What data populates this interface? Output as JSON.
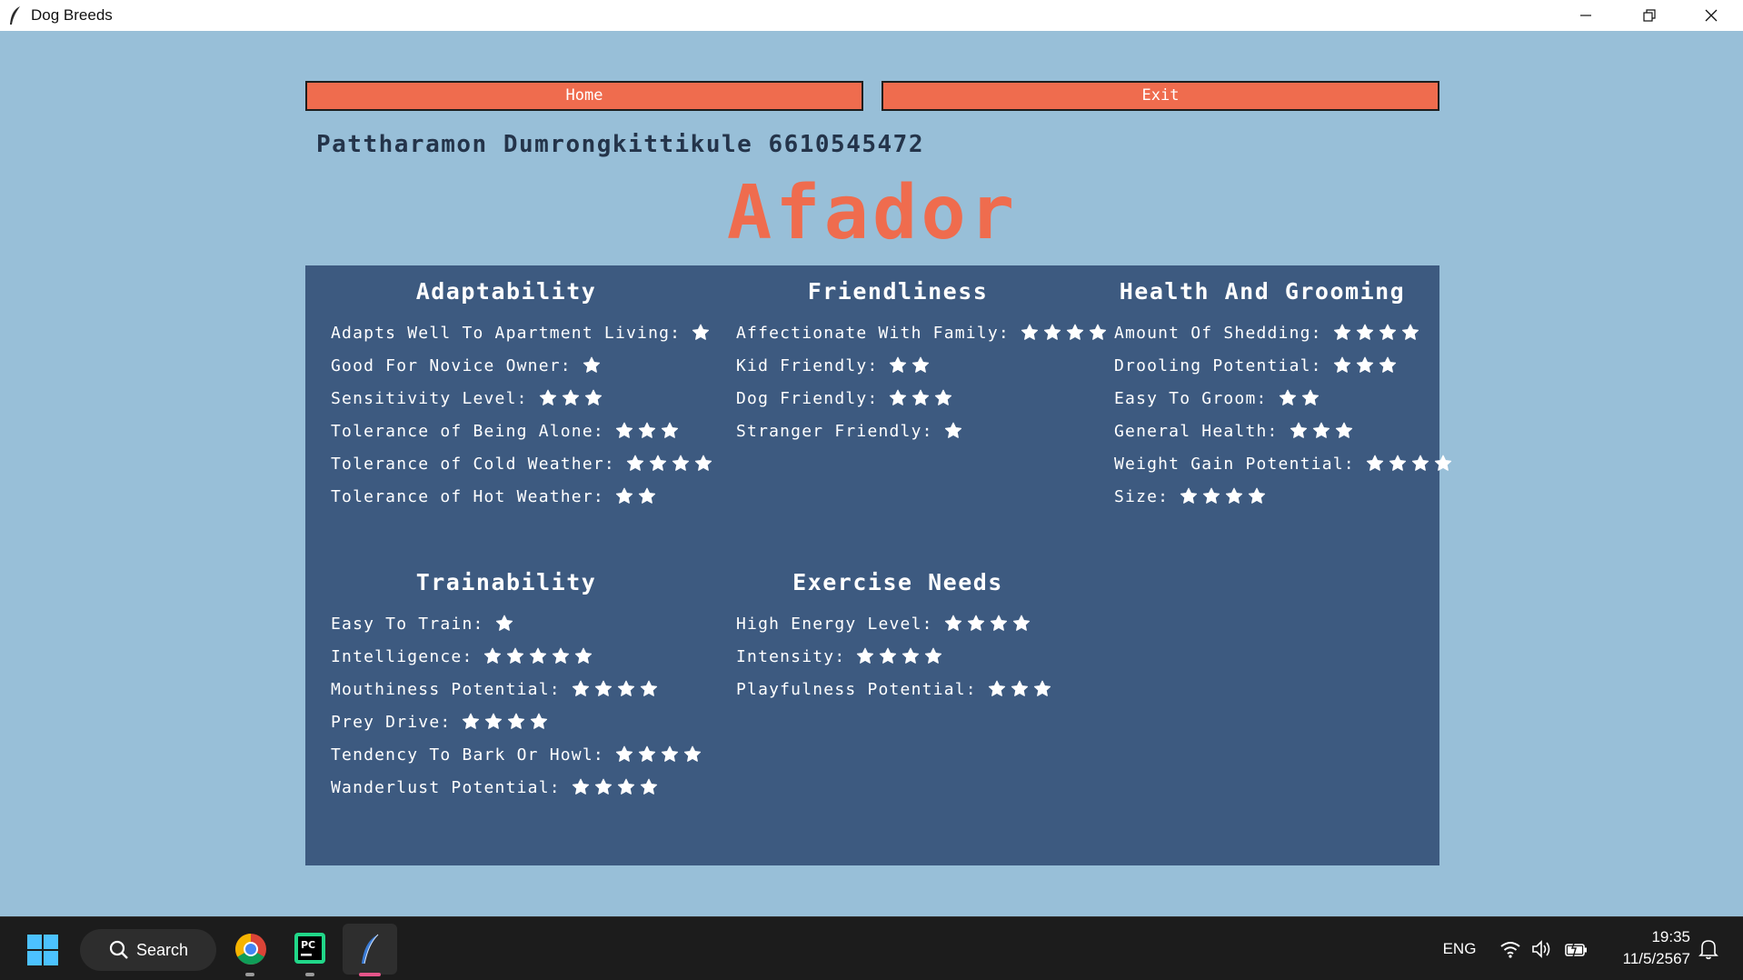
{
  "window": {
    "title": "Dog Breeds"
  },
  "toolbar": {
    "home_label": "Home",
    "exit_label": "Exit"
  },
  "student": "Pattharamon Dumrongkittikule 6610545472",
  "breed": "Afador",
  "colors": {
    "background": "#98bfd8",
    "panel": "#3d5a80",
    "accent": "#ef6c4e",
    "text_dark": "#24344a",
    "star": "#ffffff"
  },
  "sections": {
    "adaptability": {
      "title": "Adaptability",
      "items": [
        {
          "label": "Adapts Well To Apartment Living:",
          "stars": 1
        },
        {
          "label": "Good For Novice Owner:",
          "stars": 1
        },
        {
          "label": "Sensitivity Level:",
          "stars": 3
        },
        {
          "label": "Tolerance of Being Alone:",
          "stars": 3
        },
        {
          "label": "Tolerance of Cold Weather:",
          "stars": 4
        },
        {
          "label": "Tolerance of Hot Weather:",
          "stars": 2
        }
      ]
    },
    "friendliness": {
      "title": "Friendliness",
      "items": [
        {
          "label": "Affectionate With Family:",
          "stars": 4
        },
        {
          "label": "Kid Friendly:",
          "stars": 2
        },
        {
          "label": "Dog Friendly:",
          "stars": 3
        },
        {
          "label": "Stranger Friendly:",
          "stars": 1
        }
      ]
    },
    "health": {
      "title": "Health And Grooming",
      "items": [
        {
          "label": "Amount Of Shedding:",
          "stars": 4
        },
        {
          "label": "Drooling Potential:",
          "stars": 3
        },
        {
          "label": "Easy To Groom:",
          "stars": 2
        },
        {
          "label": "General Health:",
          "stars": 3
        },
        {
          "label": "Weight Gain Potential:",
          "stars": 4
        },
        {
          "label": "Size:",
          "stars": 4
        }
      ]
    },
    "trainability": {
      "title": "Trainability",
      "items": [
        {
          "label": "Easy To Train:",
          "stars": 1
        },
        {
          "label": "Intelligence:",
          "stars": 5
        },
        {
          "label": "Mouthiness Potential:",
          "stars": 4
        },
        {
          "label": "Prey Drive:",
          "stars": 4
        },
        {
          "label": "Tendency To Bark Or Howl:",
          "stars": 4
        },
        {
          "label": "Wanderlust Potential:",
          "stars": 4
        }
      ]
    },
    "exercise": {
      "title": "Exercise Needs",
      "items": [
        {
          "label": "High Energy Level:",
          "stars": 4
        },
        {
          "label": "Intensity:",
          "stars": 4
        },
        {
          "label": "Playfulness Potential:",
          "stars": 3
        }
      ]
    }
  },
  "taskbar": {
    "search_label": "Search",
    "language": "ENG",
    "time": "19:35",
    "date": "11/5/2567",
    "icons": [
      "windows-start-icon",
      "search-icon",
      "chrome-icon",
      "pycharm-icon",
      "feather-app-icon",
      "wifi-icon",
      "volume-icon",
      "battery-icon",
      "notification-bell-icon"
    ]
  }
}
